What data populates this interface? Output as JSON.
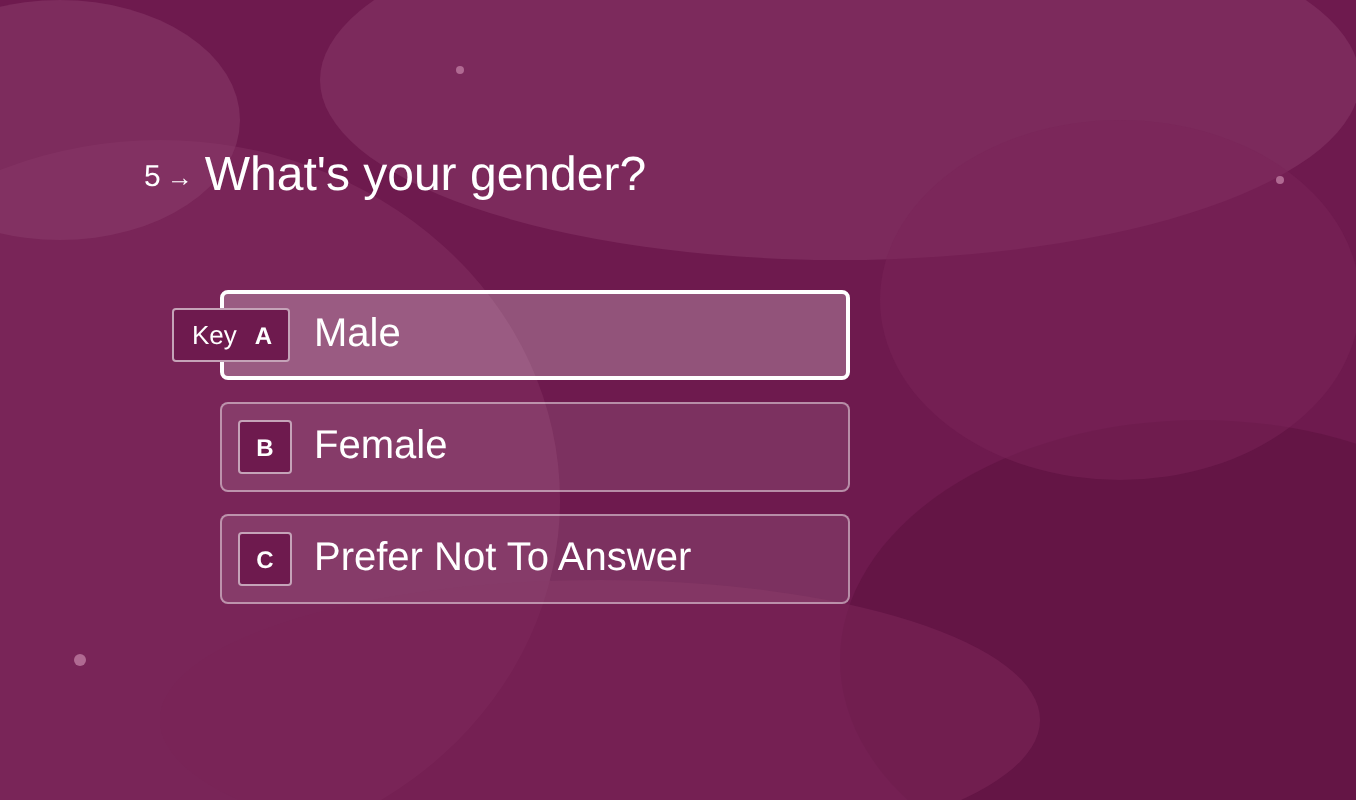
{
  "question": {
    "number": "5",
    "arrow": "→",
    "text": "What's your gender?"
  },
  "choices": [
    {
      "key": "A",
      "hint": "Key",
      "label": "Male",
      "selected": true
    },
    {
      "key": "B",
      "label": "Female",
      "selected": false
    },
    {
      "key": "C",
      "label": "Prefer Not To Answer",
      "selected": false
    }
  ]
}
